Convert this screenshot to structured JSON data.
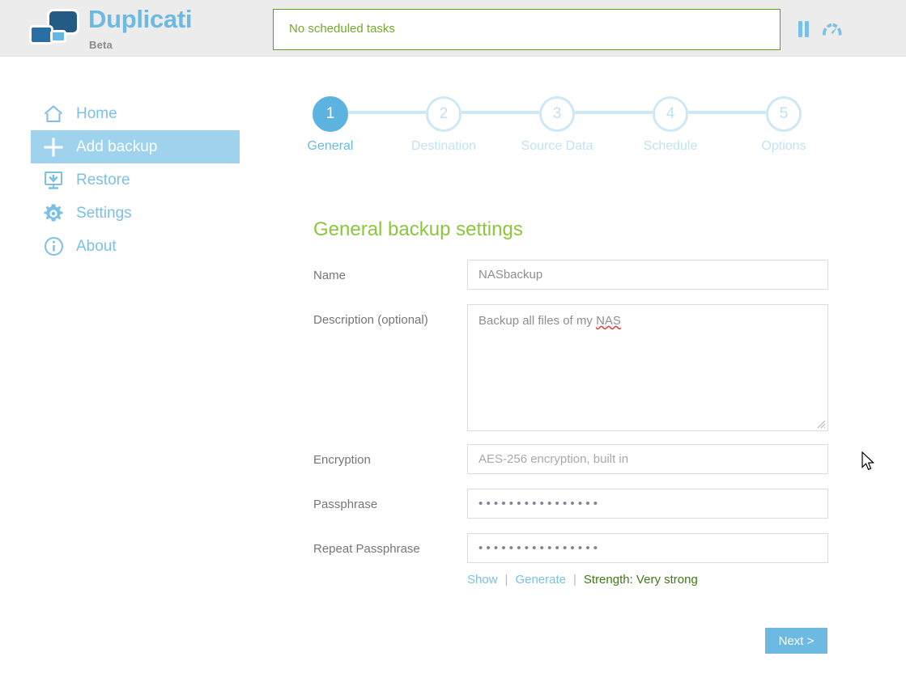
{
  "header": {
    "brand_title": "Duplicati",
    "brand_sub": "Beta",
    "status_text": "No scheduled tasks",
    "pause_icon": "pause-icon",
    "throttle_icon": "speedometer-icon",
    "status_border_color": "#5d9e1e",
    "status_text_color": "#74a830",
    "brand_color": "#6cb9e2"
  },
  "sidebar": {
    "items": [
      {
        "label": "Home",
        "icon": "home-icon",
        "active": false
      },
      {
        "label": "Add backup",
        "icon": "plus-icon",
        "active": true
      },
      {
        "label": "Restore",
        "icon": "restore-icon",
        "active": false
      },
      {
        "label": "Settings",
        "icon": "gear-icon",
        "active": false
      },
      {
        "label": "About",
        "icon": "info-icon",
        "active": false
      }
    ],
    "active_bg": "#9fd3ed",
    "link_color": "#7cc0e5"
  },
  "steps": {
    "items": [
      {
        "number": "1",
        "label": "General",
        "active": true
      },
      {
        "number": "2",
        "label": "Destination",
        "active": false
      },
      {
        "number": "3",
        "label": "Source Data",
        "active": false
      },
      {
        "number": "4",
        "label": "Schedule",
        "active": false
      },
      {
        "number": "5",
        "label": "Options",
        "active": false
      }
    ],
    "active_color": "#5cb3e0",
    "inactive_color": "#cfe8f6"
  },
  "form": {
    "title": "General backup settings",
    "title_color": "#8cc63e",
    "name": {
      "label": "Name",
      "value": "NASbackup",
      "placeholder": ""
    },
    "description": {
      "label": "Description (optional)",
      "value_before": "Backup all files of my ",
      "value_misspelled": "NAS",
      "placeholder": ""
    },
    "encryption": {
      "label": "Encryption",
      "value": "AES-256 encryption, built in"
    },
    "passphrase": {
      "label": "Passphrase",
      "value": "••••••••••••••••",
      "dots": 16
    },
    "repeat_passphrase": {
      "label": "Repeat Passphrase",
      "value": "••••••••••••••••",
      "dots": 16
    },
    "tools": {
      "show": "Show",
      "separator": "|",
      "generate": "Generate",
      "strength": "Strength: Very strong",
      "strength_color": "#3e7a16"
    },
    "next_button": "Next >"
  }
}
